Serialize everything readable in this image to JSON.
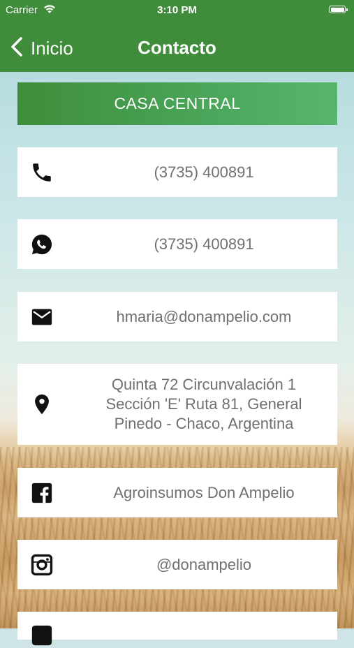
{
  "status_bar": {
    "carrier": "Carrier",
    "time": "3:10 PM"
  },
  "nav": {
    "back_label": "Inicio",
    "title": "Contacto"
  },
  "banner": {
    "label": "CASA CENTRAL"
  },
  "contacts": {
    "phone": {
      "value": "(3735) 400891",
      "icon": "phone-icon"
    },
    "whatsapp": {
      "value": "(3735) 400891",
      "icon": "whatsapp-icon"
    },
    "email": {
      "value": "hmaria@donampelio.com",
      "icon": "mail-icon"
    },
    "address": {
      "line1": "Quinta 72 Circunvalación 1",
      "line2": "Sección 'E' Ruta 81, General",
      "line3": "Pinedo - Chaco, Argentina",
      "icon": "location-pin-icon"
    },
    "facebook": {
      "value": "Agroinsumos Don Ampelio",
      "icon": "facebook-icon"
    },
    "instagram": {
      "value": "@donampelio",
      "icon": "instagram-icon"
    }
  },
  "colors": {
    "header": "#3f8d3a",
    "text": "#707070",
    "card": "#ffffff"
  }
}
